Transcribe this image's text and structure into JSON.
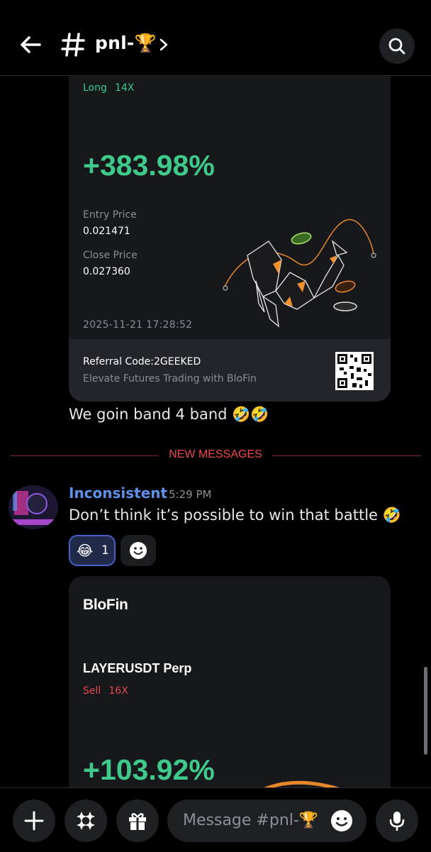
{
  "header": {
    "channel_name": "pnl-",
    "channel_emoji": "🏆"
  },
  "card1": {
    "direction": "Long",
    "leverage": "14X",
    "pnl": "+383.98%",
    "entry_label": "Entry Price",
    "entry_value": "0.021471",
    "close_label": "Close Price",
    "close_value": "0.027360",
    "timestamp": "2025-11-21 17:28:52",
    "referral": "Referral Code:2GEEKED",
    "tagline": "Elevate Futures Trading with BloFin"
  },
  "message1": {
    "text": "We goin band 4 band",
    "emoji": "🤣🤣"
  },
  "divider": {
    "label": "NEW MESSAGES"
  },
  "message2": {
    "author": "Inconsistent",
    "time": "5:29 PM",
    "text": "Don’t think it’s possible to win that battle",
    "emoji": "🤣",
    "reaction_emoji": "😂",
    "reaction_count": "1"
  },
  "card2": {
    "brand": "BloFin",
    "pair": "LAYERUSDT Perp",
    "direction": "Sell",
    "leverage": "16X",
    "pnl": "+103.92%"
  },
  "composer": {
    "placeholder": "Message #pnl-",
    "placeholder_emoji": "🏆"
  },
  "colors": {
    "green": "#3fc98a",
    "red_sell": "#e5484d",
    "author_blue": "#5d92e8",
    "new_messages_red": "#f04747"
  }
}
